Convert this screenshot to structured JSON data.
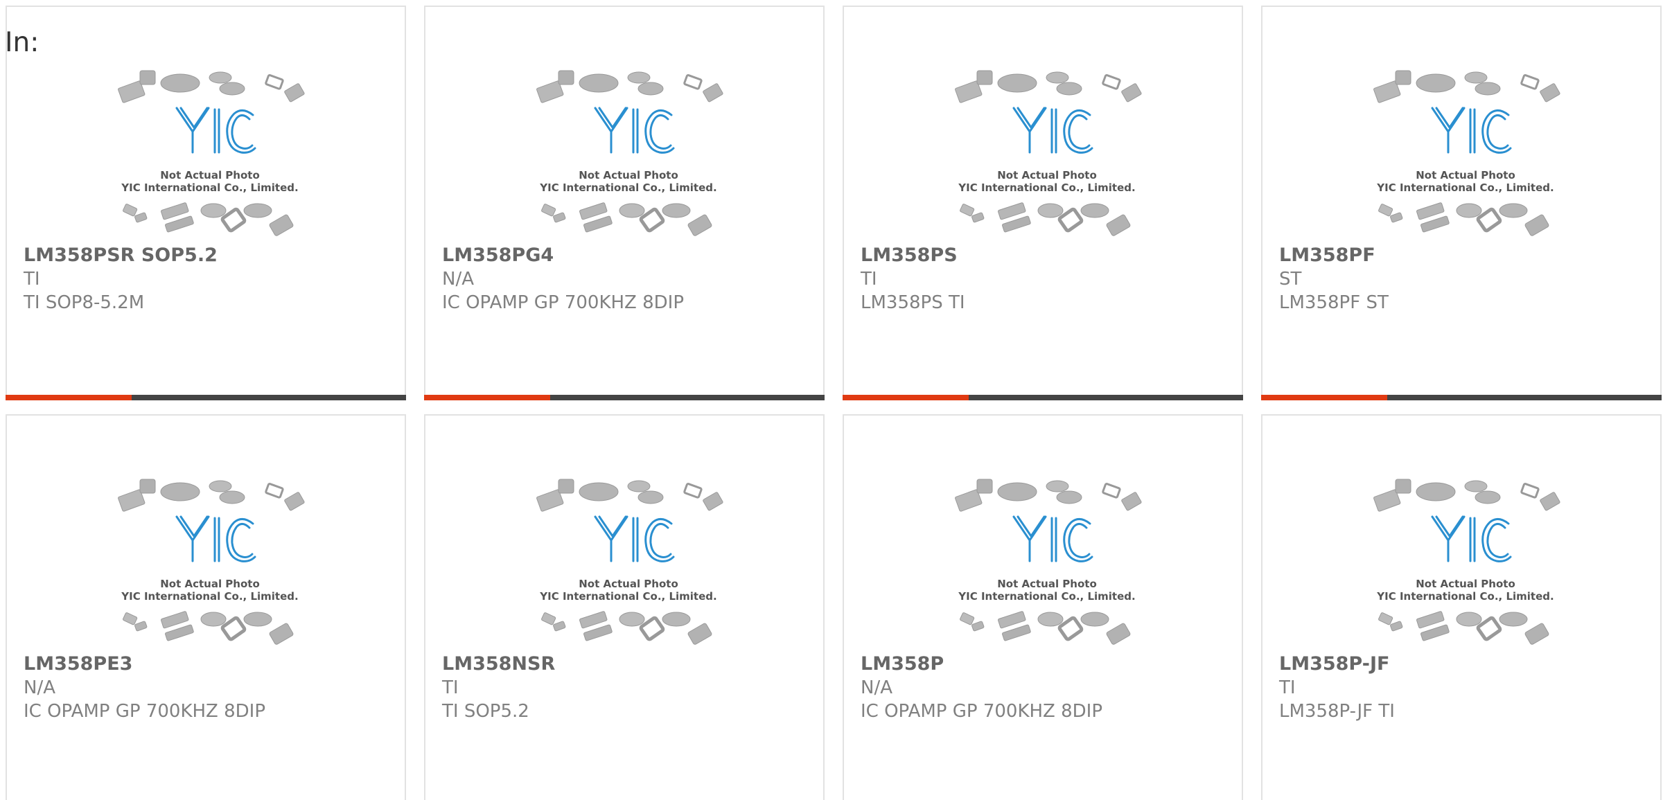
{
  "header": {
    "label": "In:"
  },
  "thumbnail": {
    "brand": "YIC",
    "line1": "Not Actual Photo",
    "line2": "YIC International Co., Limited."
  },
  "colors": {
    "accent": "#e03a12",
    "bar": "#444444",
    "logo": "#2a8fd0"
  },
  "products": [
    {
      "part": "LM358PSR SOP5.2",
      "maker": "TI",
      "desc": "TI SOP8-5.2M"
    },
    {
      "part": "LM358PG4",
      "maker": "N/A",
      "desc": "IC OPAMP GP 700KHZ 8DIP"
    },
    {
      "part": "LM358PS",
      "maker": "TI",
      "desc": "LM358PS TI"
    },
    {
      "part": "LM358PF",
      "maker": "ST",
      "desc": "LM358PF ST"
    },
    {
      "part": "LM358PE3",
      "maker": "N/A",
      "desc": "IC OPAMP GP 700KHZ 8DIP"
    },
    {
      "part": "LM358NSR",
      "maker": "TI",
      "desc": "TI SOP5.2"
    },
    {
      "part": "LM358P",
      "maker": "N/A",
      "desc": "IC OPAMP GP 700KHZ 8DIP"
    },
    {
      "part": "LM358P-JF",
      "maker": "TI",
      "desc": "LM358P-JF TI"
    }
  ]
}
